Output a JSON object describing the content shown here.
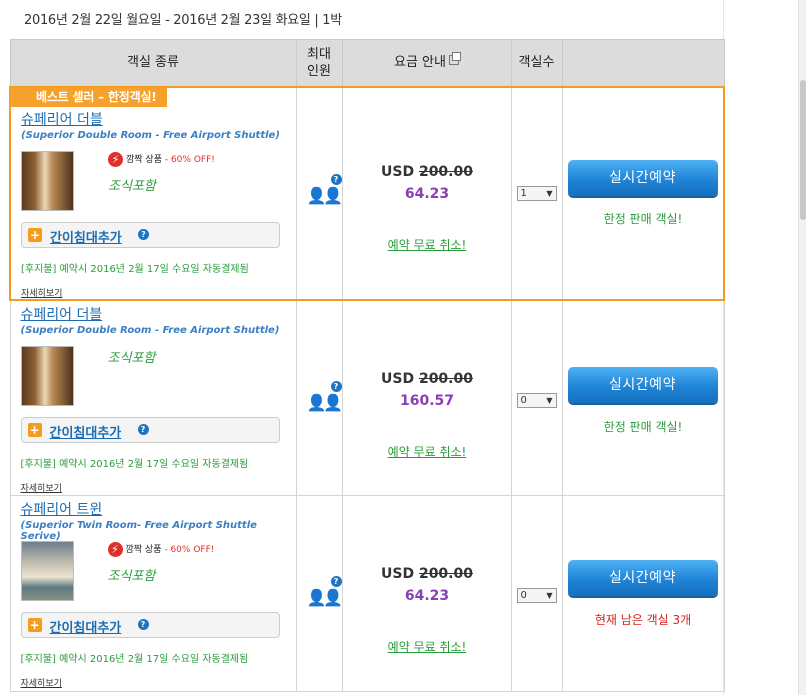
{
  "stay": "2016년 2월 22일 월요일 - 2016년 2월 23일 화요일 | 1박",
  "headers": {
    "room_type": "객실 종류",
    "max_guests_line1": "최대",
    "max_guests_line2": "인원",
    "rate": "요금 안내",
    "rooms_qty": "객실수"
  },
  "rooms": [
    {
      "badge": "베스트 셀러 – 한정객실!",
      "name": "슈페리어 더블",
      "subtitle": "(Superior Double Room - Free Airport Shuttle)",
      "deal_label": "깜짝 상품",
      "deal_off": " - 60% OFF!",
      "meal": "조식포함",
      "extrabed": "간이침대추가",
      "policy": "[후지불] 예약시 2016년 2월 17일 수요일 자동결제됨",
      "details": "자세히보기",
      "currency_old": "USD ",
      "old_price": "200.00",
      "new_price": "64.23",
      "cancel": "예약 무료 취소!",
      "qty": "1",
      "book": "실시간예약",
      "availability": "한정 판매 객실!"
    },
    {
      "name": "슈페리어 더블",
      "subtitle": "(Superior Double Room - Free Airport Shuttle)",
      "meal": "조식포함",
      "extrabed": "간이침대추가",
      "policy": "[후지불] 예약시 2016년 2월 17일 수요일 자동결제됨",
      "details": "자세히보기",
      "currency_old": "USD ",
      "old_price": "200.00",
      "new_price": "160.57",
      "cancel": "예약 무료 취소!",
      "qty": "0",
      "book": "실시간예약",
      "availability": "한정 판매 객실!"
    },
    {
      "name": "슈페리어 트윈",
      "subtitle": "(Superior Twin Room- Free Airport Shuttle Serive)",
      "deal_label": "깜짝 상품",
      "deal_off": " - 60% OFF!",
      "meal": "조식포함",
      "extrabed": "간이침대추가",
      "policy": "[후지불] 예약시 2016년 2월 17일 수요일 자동결제됨",
      "details": "자세히보기",
      "currency_old": "USD ",
      "old_price": "200.00",
      "new_price": "64.23",
      "cancel": "예약 무료 취소!",
      "qty": "0",
      "book": "실시간예약",
      "availability": "현재 남은 객실 3개"
    }
  ],
  "colors": {
    "accent_orange": "#f39c1d",
    "link_blue": "#1a6db3",
    "price_purple": "#8a3fb3",
    "green": "#2a9d3c",
    "red": "#d6221c"
  }
}
